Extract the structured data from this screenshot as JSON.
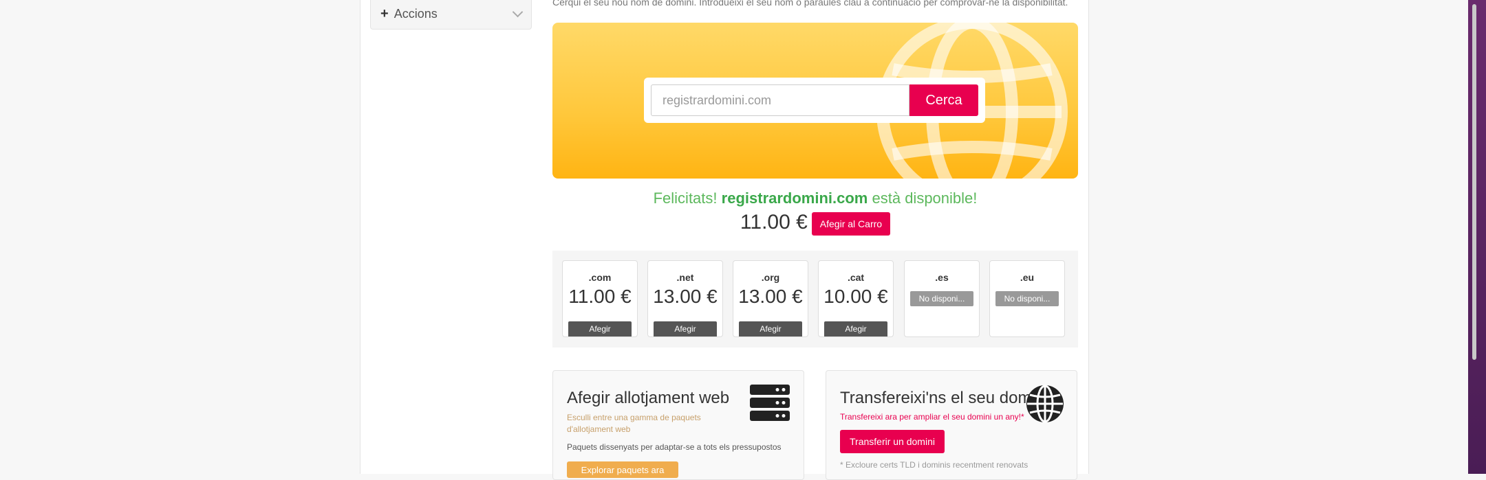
{
  "sidebar": {
    "actions_label": "Accions"
  },
  "intro_text": "Cerqui el seu nou nom de domini. Introdueixi el seu nom o paraules clau a continuació per comprovar-ne la disponibilitat.",
  "search": {
    "placeholder": "registrardomini.com",
    "button_label": "Cerca"
  },
  "result": {
    "prefix": "Felicitats!",
    "domain": "registrardomini.com",
    "suffix": "està disponible!",
    "price": "11.00 €",
    "add_to_cart_label": "Afegir al Carro"
  },
  "tlds": [
    {
      "name": ".com",
      "price": "11.00 €",
      "button": "Afegir",
      "available": true
    },
    {
      "name": ".net",
      "price": "13.00 €",
      "button": "Afegir",
      "available": true
    },
    {
      "name": ".org",
      "price": "13.00 €",
      "button": "Afegir",
      "available": true
    },
    {
      "name": ".cat",
      "price": "10.00 €",
      "button": "Afegir",
      "available": true
    },
    {
      "name": ".es",
      "status": "No disponi...",
      "available": false
    },
    {
      "name": ".eu",
      "status": "No disponi...",
      "available": false
    }
  ],
  "hosting_promo": {
    "title": "Afegir allotjament web",
    "subtitle": "Esculli entre una gamma de paquets d'allotjament web",
    "description": "Paquets dissenyats per adaptar-se a tots els pressupostos",
    "button_label": "Explorar paquets ara",
    "icon": "server-icon"
  },
  "transfer_promo": {
    "title": "Transfereixi'ns el seu domini",
    "tagline": "Transfereixi ara per ampliar el seu domini un any!*",
    "button_label": "Transferir un domini",
    "footnote": "* Excloure certs TLD i dominis recentment renovats",
    "icon": "globe-icon"
  },
  "colors": {
    "accent": "#e8004f",
    "success": "#5cb85c",
    "hero_yellow": "#ffc73a"
  }
}
